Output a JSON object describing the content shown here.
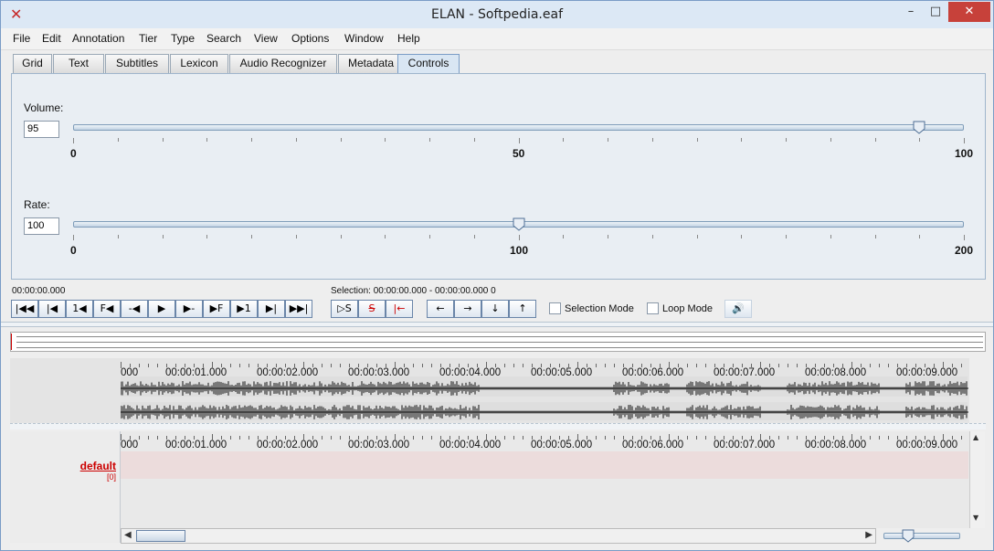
{
  "window": {
    "title": "ELAN - Softpedia.eaf"
  },
  "menu": [
    "File",
    "Edit",
    "Annotation",
    "Tier",
    "Type",
    "Search",
    "View",
    "Options",
    "Window",
    "Help"
  ],
  "tabs": [
    "Grid",
    "Text",
    "Subtitles",
    "Lexicon",
    "Audio Recognizer",
    "Metadata",
    "Controls"
  ],
  "active_tab": "Controls",
  "volume": {
    "label": "Volume:",
    "value": "95",
    "level": 95,
    "min": 0,
    "max": 100,
    "ticks": [
      "0",
      "50",
      "100"
    ]
  },
  "rate": {
    "label": "Rate:",
    "value": "100",
    "level": 100,
    "min": 0,
    "max": 200,
    "ticks": [
      "0",
      "100",
      "200"
    ]
  },
  "media": {
    "current_time": "00:00:00.000",
    "selection": "Selection: 00:00:00.000 - 00:00:00.000  0",
    "buttons": [
      "|◀◀",
      "|◀",
      "1◀",
      "F◀",
      "-◀",
      "▶",
      "▶-",
      "▶F",
      "▶1",
      "▶|",
      "▶▶|"
    ],
    "sel_buttons": [
      "▷S",
      "S",
      "|←"
    ],
    "nav_buttons": [
      "←",
      "→",
      "↓",
      "↑"
    ],
    "selection_mode": "Selection Mode",
    "loop_mode": "Loop Mode"
  },
  "timeline": {
    "labels": [
      "000",
      "00:00:01.000",
      "00:00:02.000",
      "00:00:03.000",
      "00:00:04.000",
      "00:00:05.000",
      "00:00:06.000",
      "00:00:07.000",
      "00:00:08.000",
      "00:00:09.000"
    ]
  },
  "tier": {
    "name": "default",
    "count": "[0]"
  },
  "colors": {
    "accent": "#7a9cc6",
    "tier_label": "#cc0000",
    "tier_row": "#ecdcdc"
  }
}
